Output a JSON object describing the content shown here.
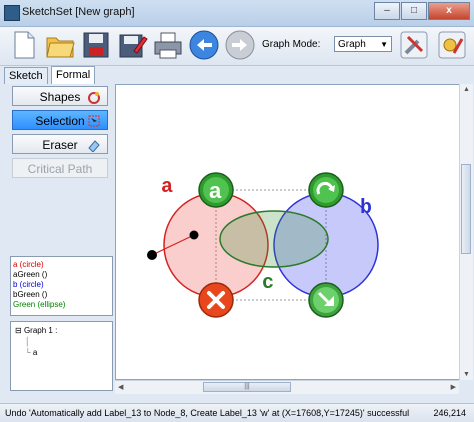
{
  "window": {
    "title": "SketchSet [New graph]",
    "minimize": "–",
    "maximize": "□",
    "close": "x"
  },
  "toolbar": {
    "buttons": [
      "new-file-icon",
      "open-folder-icon",
      "save-icon",
      "save-as-icon",
      "print-icon",
      "undo-icon",
      "redo-icon",
      "clipboard-icon"
    ],
    "graph_mode_label": "Graph Mode:",
    "graph_mode_value": "Graph",
    "right_buttons": [
      "tools-icon",
      "settings-icon"
    ]
  },
  "tabs": [
    {
      "label": "Sketch"
    },
    {
      "label": "Formal"
    }
  ],
  "panel": {
    "tools": [
      {
        "label": "Shapes",
        "icon": "shapes-icon"
      },
      {
        "label": "Selection",
        "icon": "selection-icon"
      },
      {
        "label": "Eraser",
        "icon": "eraser-icon"
      },
      {
        "label": "Critical Path",
        "icon": ""
      }
    ],
    "objects": [
      {
        "text": "a (circle)",
        "color": "#d00000"
      },
      {
        "text": "aGreen ()",
        "color": "#000000"
      },
      {
        "text": "b (circle)",
        "color": "#0000c8"
      },
      {
        "text": "bGreen ()",
        "color": "#000000"
      },
      {
        "text": "Green (ellipse)",
        "color": "#008000"
      }
    ],
    "tree": {
      "root": "Graph 1 :",
      "child": "a"
    }
  },
  "canvas": {
    "label_a": "a",
    "label_b": "b",
    "label_c": "c",
    "node_a_letter": "a",
    "colors": {
      "red": "#ef3b3b",
      "blue": "#3a3df0",
      "green": "#2f8f2f"
    }
  },
  "hscroll": {
    "grip": "|||"
  },
  "status": {
    "message": "Undo 'Automatically add Label_13 to Node_8, Create Label_13 'w' at (X=17608,Y=17245)' successful",
    "coords": "246,214"
  }
}
